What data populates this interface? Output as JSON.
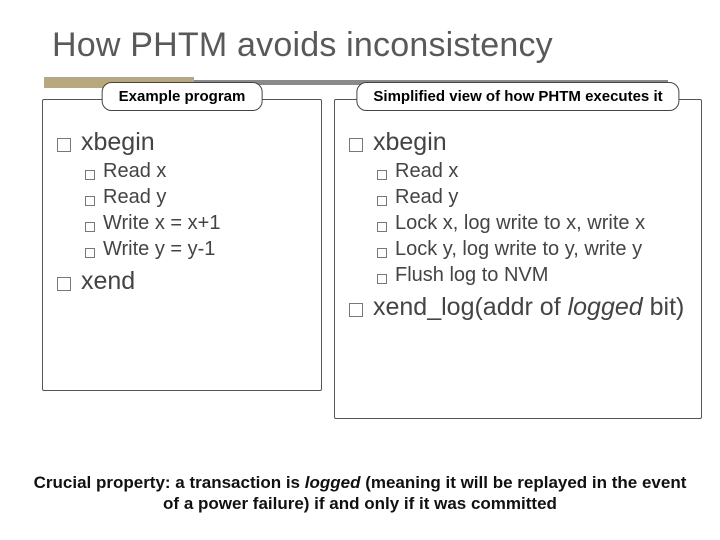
{
  "title": "How PHTM avoids inconsistency",
  "left": {
    "header": "Example program",
    "l1a": "xbegin",
    "items": [
      "Read x",
      "Read y",
      "Write x = x+1",
      "Write y = y-1"
    ],
    "l1b": "xend"
  },
  "right": {
    "header": "Simplified view of how PHTM executes it",
    "l1a": "xbegin",
    "items": [
      "Read x",
      "Read y",
      "Lock x, log write to x, write x",
      "Lock y, log write to y, write y",
      "Flush log to NVM"
    ],
    "l1b_pre": "xend_log(addr of ",
    "l1b_it": "logged",
    "l1b_post": " bit)"
  },
  "footnote": {
    "pre": "Crucial property: a transaction is ",
    "it": "logged",
    "mid": " (meaning it will be replayed in the event of a power failure) if and only if it was committed"
  }
}
